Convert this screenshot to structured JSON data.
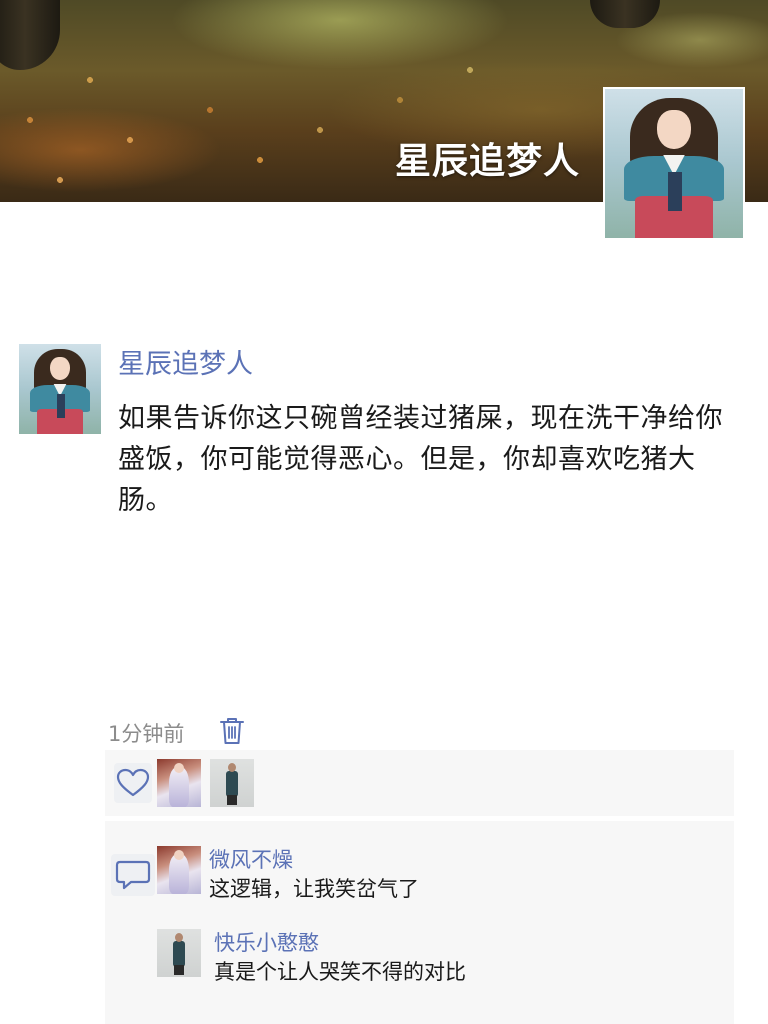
{
  "profile": {
    "cover_name": "星辰追梦人",
    "cover_image": "autumn-forest-cover",
    "avatar": "hanbok-woman-avatar"
  },
  "post": {
    "author": "星辰追梦人",
    "text": "如果告诉你这只碗曾经装过猪屎，现在洗干净给你盛饭，你可能觉得恶心。但是，你却喜欢吃猪大肠。",
    "time": "1分钟前",
    "delete_icon": "trash-icon"
  },
  "likes": {
    "icon": "heart-icon",
    "users": [
      "liker-avatar-1",
      "liker-avatar-2"
    ]
  },
  "comments": {
    "icon": "comment-icon",
    "items": [
      {
        "author": "微风不燥",
        "text": "这逻辑，让我笑岔气了"
      },
      {
        "author": "快乐小憨憨",
        "text": "真是个让人哭笑不得的对比"
      }
    ]
  },
  "colors": {
    "name_blue": "#5b72b6",
    "timestamp_gray": "#8c8c8c",
    "panel_bg": "#f7f7f7",
    "icon_blue": "#5b72b6"
  }
}
